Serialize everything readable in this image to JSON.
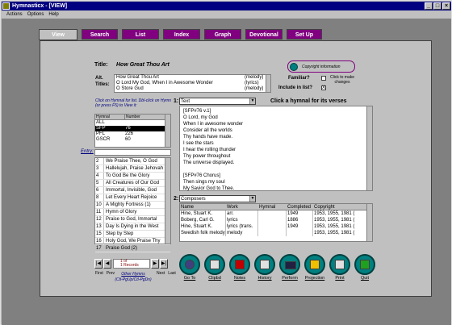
{
  "window": {
    "title": "Hymnasticx - [VIEW]"
  },
  "menu": [
    "Actions",
    "Options",
    "Help"
  ],
  "tabs": [
    "View",
    "Search",
    "List",
    "Index",
    "Graph",
    "Devotional",
    "Set Up"
  ],
  "hymn": {
    "title_label": "Title:",
    "title": "How Great Thou Art",
    "alt_label_line1": "Alt.",
    "alt_label_line2": "Titles:",
    "alt_titles": [
      {
        "title": "How Great Thou Art",
        "role": "(melody)"
      },
      {
        "title": "O Lord My God, When I in Awesome Wonder",
        "role": "(lyrics)"
      },
      {
        "title": "O Store Gud",
        "role": "(melody)"
      }
    ]
  },
  "copyright": {
    "label": "Copyright information"
  },
  "familiar": {
    "label": "Familiar?",
    "checked": false
  },
  "include": {
    "label": "Include in list?",
    "checked": true,
    "mark": "X"
  },
  "click_note": "Click to make changes",
  "hint": "Click on Hymnal for list. Dbl-click on Hymn (or press F5) to View it:",
  "hymnal_table": {
    "headers": [
      "Hymnal",
      "Number"
    ],
    "rows": [
      [
        "ALL",
        ""
      ],
      [
        "SFP",
        "76"
      ],
      [
        "PFL",
        "226"
      ],
      [
        "GSCR",
        "60"
      ]
    ],
    "selected_index": 1
  },
  "entry_label": "Entry:",
  "songs": [
    {
      "n": "2",
      "t": "We Praise Thee, O God"
    },
    {
      "n": "3",
      "t": "Hallelujah, Praise Jehovah"
    },
    {
      "n": "4",
      "t": "To God Be the Glory"
    },
    {
      "n": "5",
      "t": "All Creatures of Our God"
    },
    {
      "n": "6",
      "t": "Immortal, Invisible, God"
    },
    {
      "n": "8",
      "t": "Let Every Heart Rejoice"
    },
    {
      "n": "10",
      "t": "A Mighty Fortress (1)"
    },
    {
      "n": "11",
      "t": "Hymn of Glory"
    },
    {
      "n": "12",
      "t": "Praise to God, Immortal"
    },
    {
      "n": "13",
      "t": "Day Is Dying in the West"
    },
    {
      "n": "15",
      "t": "Step by Step"
    },
    {
      "n": "16",
      "t": "Holy God, We Praise Thy"
    },
    {
      "n": "17",
      "t": "Praise God (2)"
    }
  ],
  "section1": {
    "num": "1:",
    "select": "Text",
    "caption": "Click a hymnal for its verses",
    "lines": [
      "[SFP#76  v.1]",
      "O Lord, my God",
      "When I in awesome wonder",
      "Consider all the worlds",
      "Thy hands have made.",
      "I see the stars",
      "I hear the rolling thunder",
      "Thy power throughout",
      "The universe displayed.",
      "",
      "[SFP#76  Chorus]",
      "Then sings my soul",
      "My Savior God to Thee.",
      "How great Thou art"
    ]
  },
  "section2": {
    "num": "2:",
    "select": "Composers",
    "headers": [
      "Name",
      "Work",
      "Hymnal",
      "Completed",
      "Copyright"
    ],
    "rows": [
      [
        "Hine, Stuart K.",
        "arr.",
        "",
        "1949",
        "1953, 1955, 1981 ("
      ],
      [
        "Boberg, Carl G.",
        "lyrics",
        "",
        "1886",
        "1953, 1955, 1981 ("
      ],
      [
        "Hine, Stuart K.",
        "lyrics (trans.",
        "",
        "1949",
        "1953, 1955, 1981 ("
      ],
      [
        "Swedish folk melody",
        "melody",
        "",
        "",
        "1953, 1955, 1981 ("
      ]
    ]
  },
  "nav": {
    "first": "First",
    "prev": "Prev",
    "next": "Next",
    "last": "Last",
    "counter_line1": "1     of",
    "counter_line2": "1     Records",
    "other_hymns": "Other Hymns",
    "keys_hint": "(Ctl-PgUp/Ctl-PgDn)"
  },
  "actions": [
    "Go To",
    "Clipbd",
    "Notes",
    "History",
    "Perform",
    "Projection",
    "Print",
    "Quit"
  ]
}
